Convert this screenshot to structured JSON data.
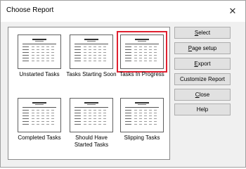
{
  "window": {
    "title": "Choose Report",
    "close_glyph": "✕"
  },
  "reports": [
    {
      "label": "Unstarted Tasks",
      "selected": false
    },
    {
      "label": "Tasks Starting Soon",
      "selected": false
    },
    {
      "label": "Tasks In Progress",
      "selected": true
    },
    {
      "label": "Completed Tasks",
      "selected": false
    },
    {
      "label": "Should Have Started Tasks",
      "selected": false
    },
    {
      "label": "Slipping Tasks",
      "selected": false
    }
  ],
  "buttons": {
    "select": {
      "mnemonic": "S",
      "rest": "elect"
    },
    "page_setup": {
      "mnemonic": "P",
      "rest": "age setup"
    },
    "export": {
      "mnemonic": "E",
      "rest": "xport"
    },
    "customize": {
      "label": "Customize Report"
    },
    "close": {
      "mnemonic": "C",
      "rest": "lose"
    },
    "help": {
      "label": "Help"
    }
  },
  "colors": {
    "selection_border": "#e02030",
    "background": "#f0f0f0"
  }
}
